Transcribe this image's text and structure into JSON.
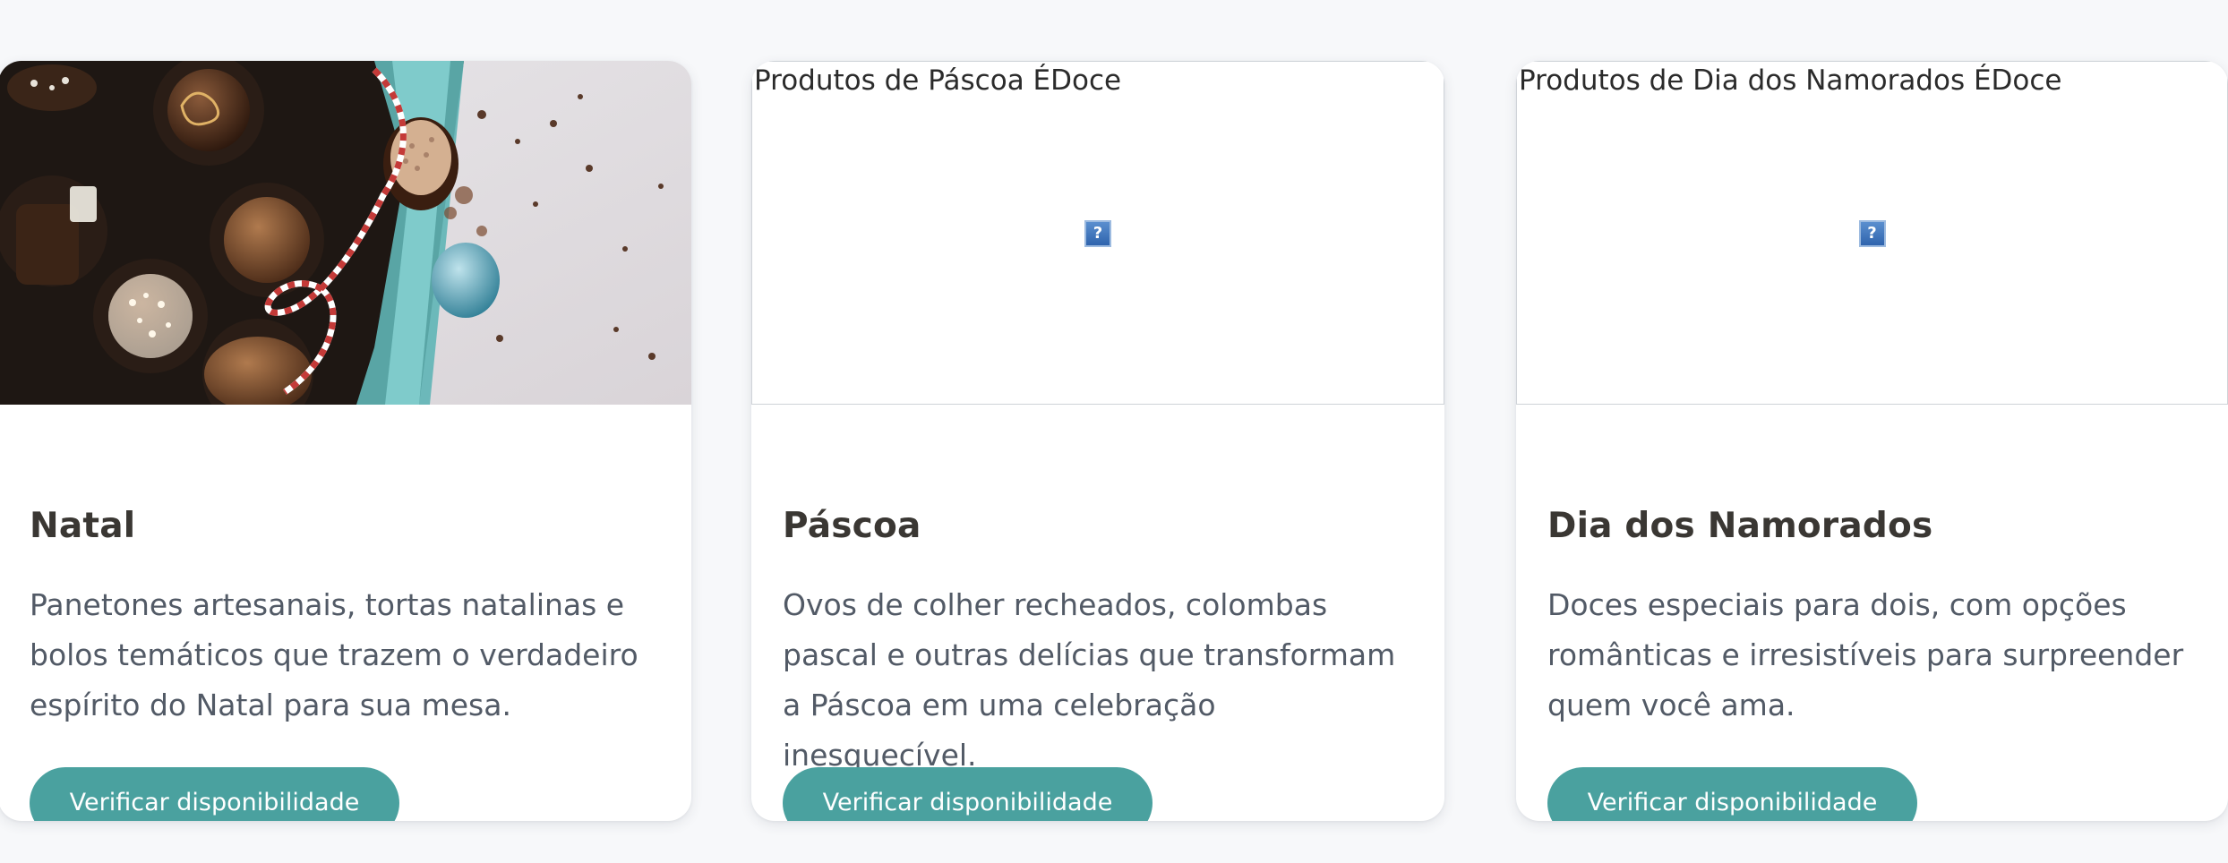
{
  "cards": [
    {
      "image_alt": "",
      "title": "Natal",
      "description": "Panetones artesanais, tortas natalinas e bolos temáticos que trazem o verdadeiro espírito do Natal para sua mesa.",
      "button_label": "Verificar disponibilidade"
    },
    {
      "image_alt": "Produtos de Páscoa ÉDoce",
      "title": "Páscoa",
      "description": "Ovos de colher recheados, colombas pascal e outras delícias que transformam a Páscoa em uma celebração inesquecível.",
      "button_label": "Verificar disponibilidade"
    },
    {
      "image_alt": "Produtos de Dia dos Namorados ÉDoce",
      "title": "Dia dos Namorados",
      "description": "Doces especiais para dois, com opções românticas e irresistíveis para surpreender quem você ama.",
      "button_label": "Verificar disponibilidade"
    }
  ],
  "broken_image_icon": "?",
  "colors": {
    "page_background": "#f7f8fa",
    "card_background": "#ffffff",
    "button": "#4aa19f",
    "title": "#3a3733",
    "description": "#525a66"
  },
  "icons": {
    "broken_image": "broken-image-icon"
  }
}
